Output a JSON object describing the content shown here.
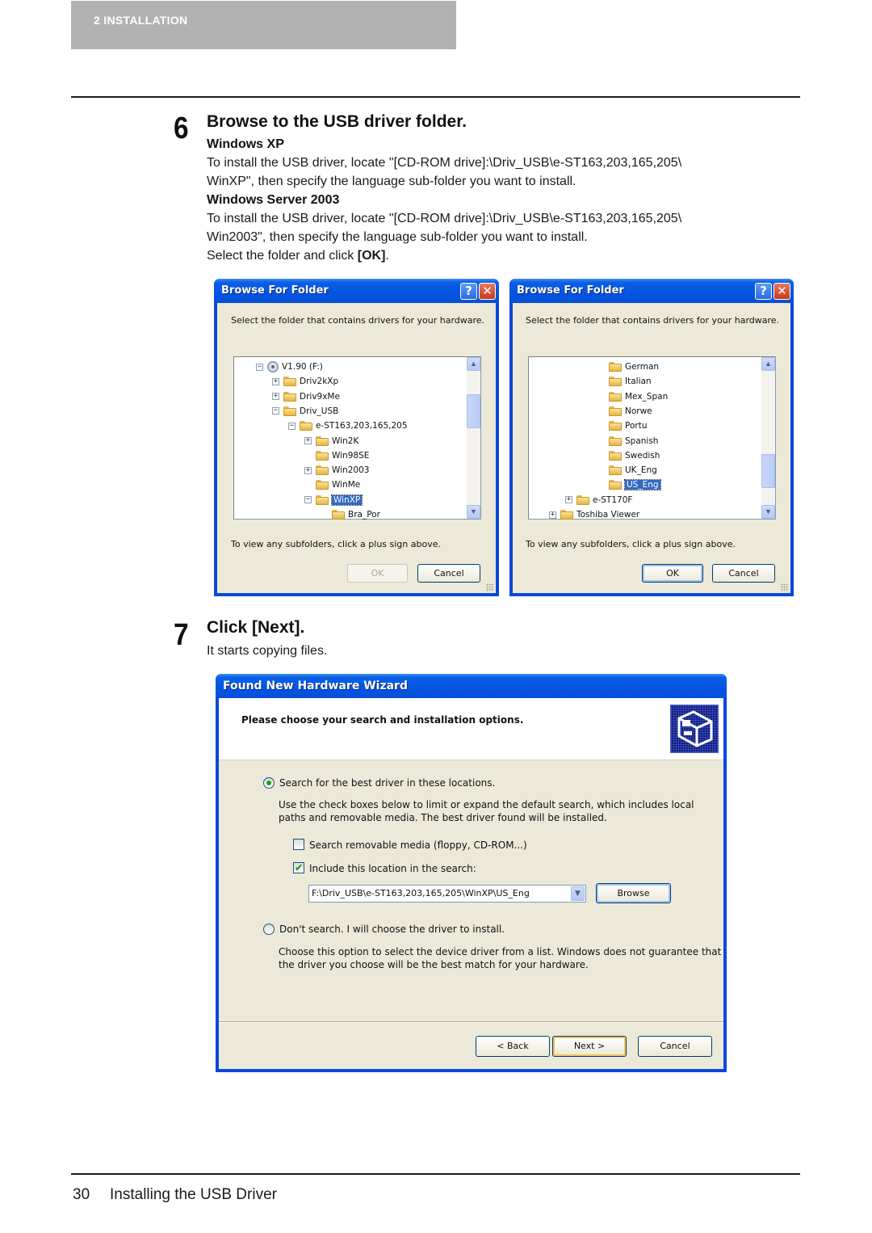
{
  "chapter": {
    "label": "2   INSTALLATION"
  },
  "step6": {
    "number": "6",
    "title": "Browse to the USB driver folder.",
    "xp_heading": "Windows XP",
    "xp_text_1": "To install the USB driver, locate \"[CD-ROM drive]:\\Driv_USB\\e-ST163,203,165,205\\",
    "xp_text_2": "WinXP\", then specify the language sub-folder you want to install.",
    "server_heading": "Windows Server 2003",
    "server_text_1": "To install the USB driver, locate \"[CD-ROM drive]:\\Driv_USB\\e-ST163,203,165,205\\",
    "server_text_2": "Win2003\", then specify the language sub-folder you want to install.",
    "select_text_pre": "Select the folder and click ",
    "select_text_bold": "[OK]",
    "select_text_post": "."
  },
  "browse_left": {
    "title": "Browse For Folder",
    "help_icon": "?",
    "close_icon": "✕",
    "prompt": "Select the folder that contains drivers for your hardware.",
    "tree": [
      {
        "label": "V1.90 (F:)",
        "level": 0,
        "toggle": "−",
        "icon": "cd-drive-icon"
      },
      {
        "label": "Driv2kXp",
        "level": 1,
        "toggle": "+",
        "icon": "folder-icon"
      },
      {
        "label": "Driv9xMe",
        "level": 1,
        "toggle": "+",
        "icon": "folder-icon"
      },
      {
        "label": "Driv_USB",
        "level": 1,
        "toggle": "−",
        "icon": "folder-icon"
      },
      {
        "label": "e-ST163,203,165,205",
        "level": 2,
        "toggle": "−",
        "icon": "folder-icon"
      },
      {
        "label": "Win2K",
        "level": 3,
        "toggle": "+",
        "icon": "folder-icon"
      },
      {
        "label": "Win98SE",
        "level": 3,
        "toggle": "",
        "icon": "folder-icon"
      },
      {
        "label": "Win2003",
        "level": 3,
        "toggle": "+",
        "icon": "folder-icon"
      },
      {
        "label": "WinMe",
        "level": 3,
        "toggle": "",
        "icon": "folder-icon"
      },
      {
        "label": "WinXP",
        "level": 3,
        "toggle": "−",
        "icon": "folder-icon",
        "selected": true
      },
      {
        "label": "Bra_Por",
        "level": 4,
        "toggle": "",
        "icon": "folder-icon"
      }
    ],
    "hint": "To view any subfolders, click a plus sign above.",
    "ok_label": "OK",
    "ok_disabled": true,
    "cancel_label": "Cancel"
  },
  "browse_right": {
    "title": "Browse For Folder",
    "help_icon": "?",
    "close_icon": "✕",
    "prompt": "Select the folder that contains drivers for your hardware.",
    "tree": [
      {
        "label": "German",
        "level": 4,
        "toggle": "",
        "icon": "folder-icon"
      },
      {
        "label": "Italian",
        "level": 4,
        "toggle": "",
        "icon": "folder-icon"
      },
      {
        "label": "Mex_Span",
        "level": 4,
        "toggle": "",
        "icon": "folder-icon"
      },
      {
        "label": "Norwe",
        "level": 4,
        "toggle": "",
        "icon": "folder-icon"
      },
      {
        "label": "Portu",
        "level": 4,
        "toggle": "",
        "icon": "folder-icon"
      },
      {
        "label": "Spanish",
        "level": 4,
        "toggle": "",
        "icon": "folder-icon"
      },
      {
        "label": "Swedish",
        "level": 4,
        "toggle": "",
        "icon": "folder-icon"
      },
      {
        "label": "UK_Eng",
        "level": 4,
        "toggle": "",
        "icon": "folder-icon"
      },
      {
        "label": "US_Eng",
        "level": 4,
        "toggle": "",
        "icon": "folder-icon",
        "selected": true
      },
      {
        "label": "e-ST170F",
        "level": 2,
        "toggle": "+",
        "icon": "folder-icon"
      },
      {
        "label": "Toshiba Viewer",
        "level": 1,
        "toggle": "+",
        "icon": "folder-icon"
      }
    ],
    "hint": "To view any subfolders, click a plus sign above.",
    "ok_label": "OK",
    "ok_disabled": false,
    "cancel_label": "Cancel"
  },
  "step7": {
    "number": "7",
    "title": "Click [Next].",
    "text": "It starts copying files."
  },
  "wizard": {
    "title": "Found New Hardware Wizard",
    "header": "Please choose your search and installation options.",
    "icon": "hardware-wizard-icon",
    "option1_label": "Search for the best driver in these locations.",
    "option1_selected": true,
    "option1_desc_1": "Use the check boxes below to limit or expand the default search, which includes local",
    "option1_desc_2": "paths and removable media. The best driver found will be installed.",
    "check1_label": "Search removable media (floppy, CD-ROM...)",
    "check1_checked": false,
    "check2_label": "Include this location in the search:",
    "check2_checked": true,
    "location_value": "F:\\Driv_USB\\e-ST163,203,165,205\\WinXP\\US_Eng",
    "browse_label": "Browse",
    "option2_label": "Don't search. I will choose the driver to install.",
    "option2_selected": false,
    "option2_desc_1": "Choose this option to select the device driver from a list.  Windows does not guarantee that",
    "option2_desc_2": "the driver you choose will be the best match for your hardware.",
    "back_label": "< Back",
    "next_label": "Next >",
    "cancel_label": "Cancel"
  },
  "footer": {
    "page_number": "30",
    "section": "Installing the USB Driver"
  }
}
